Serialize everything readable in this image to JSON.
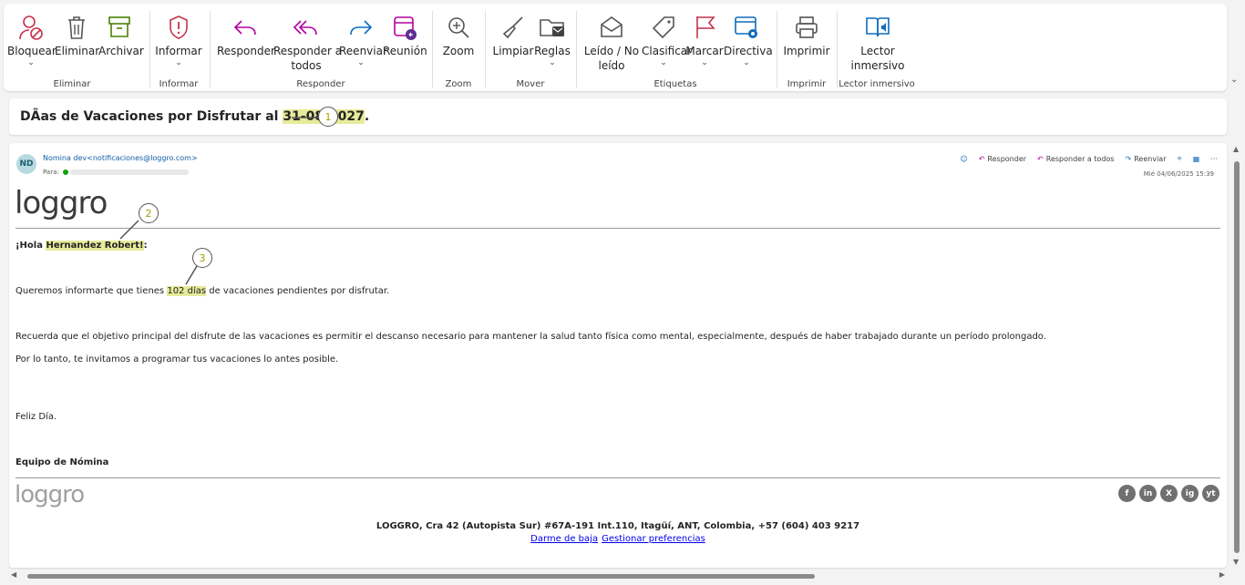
{
  "ribbon": {
    "groups": {
      "eliminar": "Eliminar",
      "informar": "Informar",
      "responder": "Responder",
      "zoom": "Zoom",
      "mover": "Mover",
      "etiquetas": "Etiquetas",
      "imprimir": "Imprimir",
      "lector": "Lector inmersivo"
    },
    "buttons": {
      "bloquear": "Bloquear",
      "eliminar": "Eliminar",
      "archivar": "Archivar",
      "informar": "Informar",
      "responder": "Responder",
      "responder_todos_1": "Responder a",
      "responder_todos_2": "todos",
      "reenviar": "Reenviar",
      "reunion": "Reunión",
      "zoom": "Zoom",
      "limpiar": "Limpiar",
      "reglas": "Reglas",
      "leido_1": "Leído / No",
      "leido_2": "leído",
      "clasificar": "Clasificar",
      "marcar": "Marcar",
      "directiva": "Directiva",
      "imprimir": "Imprimir",
      "lector_1": "Lector",
      "lector_2": "inmersivo"
    }
  },
  "subject": {
    "prefix": "DÃas de Vacaciones por Disfrutar al ",
    "date": "31-08-2027",
    "suffix": "."
  },
  "callouts": [
    "1",
    "2",
    "3"
  ],
  "mail": {
    "avatar": "ND",
    "from": "Nomina dev<notificaciones@loggro.com>",
    "to_label": "Para:",
    "actions": {
      "responder": "Responder",
      "responder_todos": "Responder a todos",
      "reenviar": "Reenviar"
    },
    "date": "Mié 04/06/2025 15:39",
    "logo": "loggro",
    "greeting_pre": "¡Hola ",
    "greeting_name": "Hernandez Robert!",
    "greeting_post": ":",
    "p1_pre": "Queremos informarte que tienes ",
    "p1_days": "102 días",
    "p1_post": " de vacaciones pendientes por disfrutar.",
    "p2": "Recuerda que el objetivo principal del disfrute de las vacaciones es permitir el descanso necesario para mantener la salud tanto física como mental, especialmente, después de haber trabajado durante un período prolongado.",
    "p3": "Por lo tanto, te invitamos a programar tus vacaciones lo antes posible.",
    "closing": "Feliz Día.",
    "signature": "Equipo de Nómina",
    "footer_address": "LOGGRO, Cra 42 (Autopista Sur) #67A-191 Int.110, Itagüí, ANT, Colombia, +57 (604) 403 9217",
    "link_baja": "Darme de baja",
    "link_pref": "Gestionar preferencias",
    "social": [
      "f",
      "in",
      "X",
      "ig",
      "yt"
    ]
  }
}
